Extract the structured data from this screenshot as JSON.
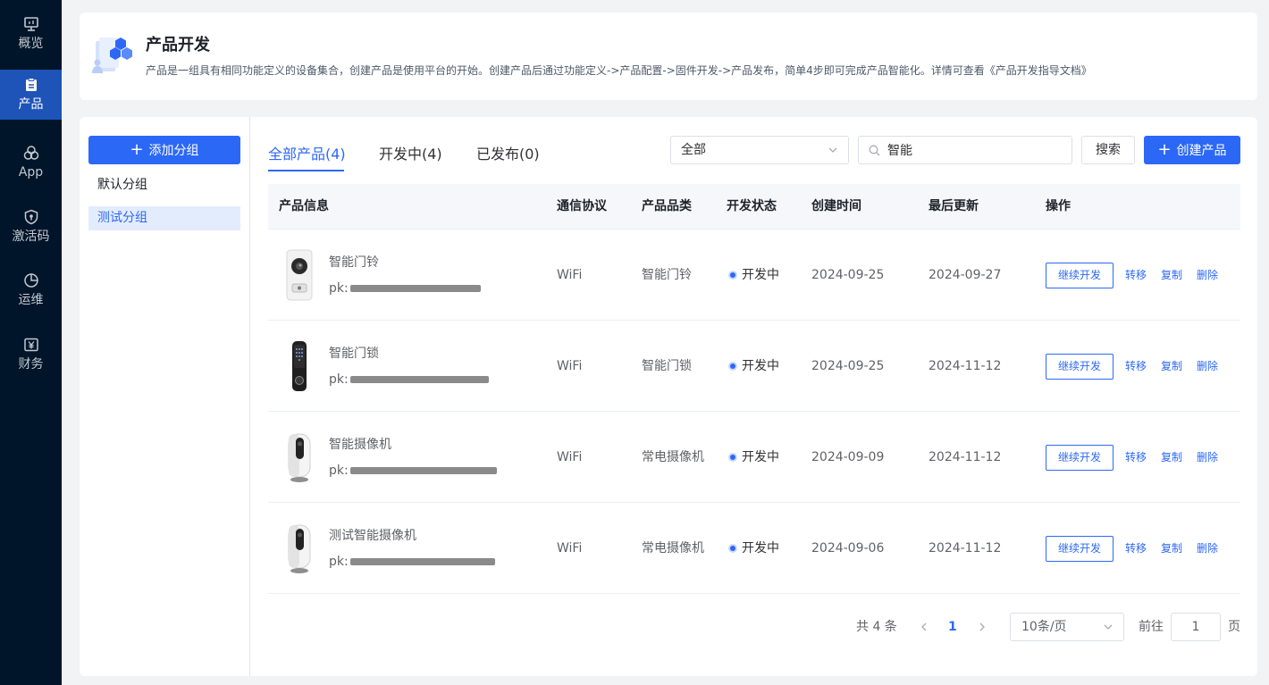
{
  "nav": {
    "items": [
      {
        "label": "概览",
        "icon": "monitor-icon"
      },
      {
        "label": "产品",
        "icon": "clipboard-icon"
      },
      {
        "label": "App",
        "icon": "circles-icon"
      },
      {
        "label": "激活码",
        "icon": "shield-icon"
      },
      {
        "label": "运维",
        "icon": "pie-chart-icon"
      },
      {
        "label": "财务",
        "icon": "yen-icon"
      }
    ],
    "active": "产品"
  },
  "header": {
    "title": "产品开发",
    "description": "产品是一组具有相同功能定义的设备集合，创建产品是使用平台的开始。创建产品后通过功能定义->产品配置->固件开发->产品发布，简单4步即可完成产品智能化。详情可查看《产品开发指导文档》"
  },
  "groups": {
    "add_label": "添加分组",
    "items": [
      "默认分组",
      "测试分组"
    ],
    "active": "测试分组"
  },
  "tabs": [
    {
      "label": "全部产品(4)"
    },
    {
      "label": "开发中(4)"
    },
    {
      "label": "已发布(0)"
    }
  ],
  "active_tab": "全部产品(4)",
  "filter": {
    "select_value": "全部",
    "search_value": "智能",
    "search_label": "搜索",
    "create_label": "创建产品"
  },
  "table": {
    "columns": [
      "产品信息",
      "通信协议",
      "产品品类",
      "开发状态",
      "创建时间",
      "最后更新",
      "操作"
    ],
    "rows": [
      {
        "name": "智能门铃",
        "pk_prefix": "pk:",
        "protocol": "WiFi",
        "category": "智能门铃",
        "status": "开发中",
        "created": "2024-09-25",
        "updated": "2024-09-27",
        "thumb": "doorbell-image"
      },
      {
        "name": "智能门锁",
        "pk_prefix": "pk:",
        "protocol": "WiFi",
        "category": "智能门锁",
        "status": "开发中",
        "created": "2024-09-25",
        "updated": "2024-11-12",
        "thumb": "door-lock-image"
      },
      {
        "name": "智能摄像机",
        "pk_prefix": "pk:",
        "protocol": "WiFi",
        "category": "常电摄像机",
        "status": "开发中",
        "created": "2024-09-09",
        "updated": "2024-11-12",
        "thumb": "camera-image"
      },
      {
        "name": "测试智能摄像机",
        "pk_prefix": "pk:",
        "protocol": "WiFi",
        "category": "常电摄像机",
        "status": "开发中",
        "created": "2024-09-06",
        "updated": "2024-11-12",
        "thumb": "camera-image"
      }
    ],
    "actions": {
      "continue": "继续开发",
      "transfer": "转移",
      "copy": "复制",
      "delete": "删除"
    }
  },
  "pagination": {
    "total": "共 4 条",
    "current_page": "1",
    "page_size": "10条/页",
    "goto_label": "前往",
    "goto_value": "1",
    "page_suffix": "页"
  },
  "colors": {
    "primary": "#2c68f6",
    "sidebar_bg": "#001529",
    "sidebar_active": "#1e53b8"
  }
}
